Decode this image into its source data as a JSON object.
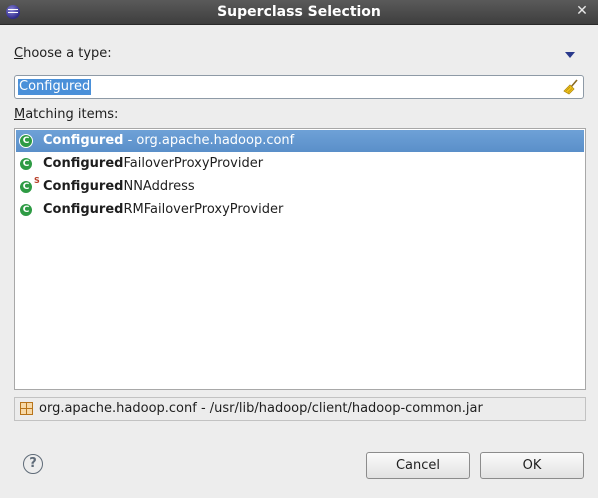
{
  "window": {
    "title": "Superclass Selection"
  },
  "chooser": {
    "label_prefix": "C",
    "label_rest": "hoose a type:"
  },
  "search": {
    "value": "Configured"
  },
  "matching": {
    "label_prefix": "M",
    "label_rest": "atching items:"
  },
  "items": [
    {
      "bold": "Configured",
      "rest": " - org.apache.hadoop.conf",
      "selected": true
    },
    {
      "bold": "Configured",
      "rest": "FailoverProxyProvider"
    },
    {
      "bold": "Configured",
      "rest": "NNAddress",
      "badge": "S"
    },
    {
      "bold": "Configured",
      "rest": "RMFailoverProxyProvider"
    }
  ],
  "status": {
    "text": "org.apache.hadoop.conf - /usr/lib/hadoop/client/hadoop-common.jar"
  },
  "buttons": {
    "cancel": "Cancel",
    "ok": "OK"
  },
  "icons": {
    "app": "eclipse-icon",
    "close": "close-icon",
    "menu": "view-menu-icon",
    "clear": "broom-clear-icon",
    "class": "class-icon",
    "package": "package-icon",
    "help": "help-icon"
  },
  "colors": {
    "selection": "#5a8fc9",
    "class_icon": "#2e9b44"
  }
}
